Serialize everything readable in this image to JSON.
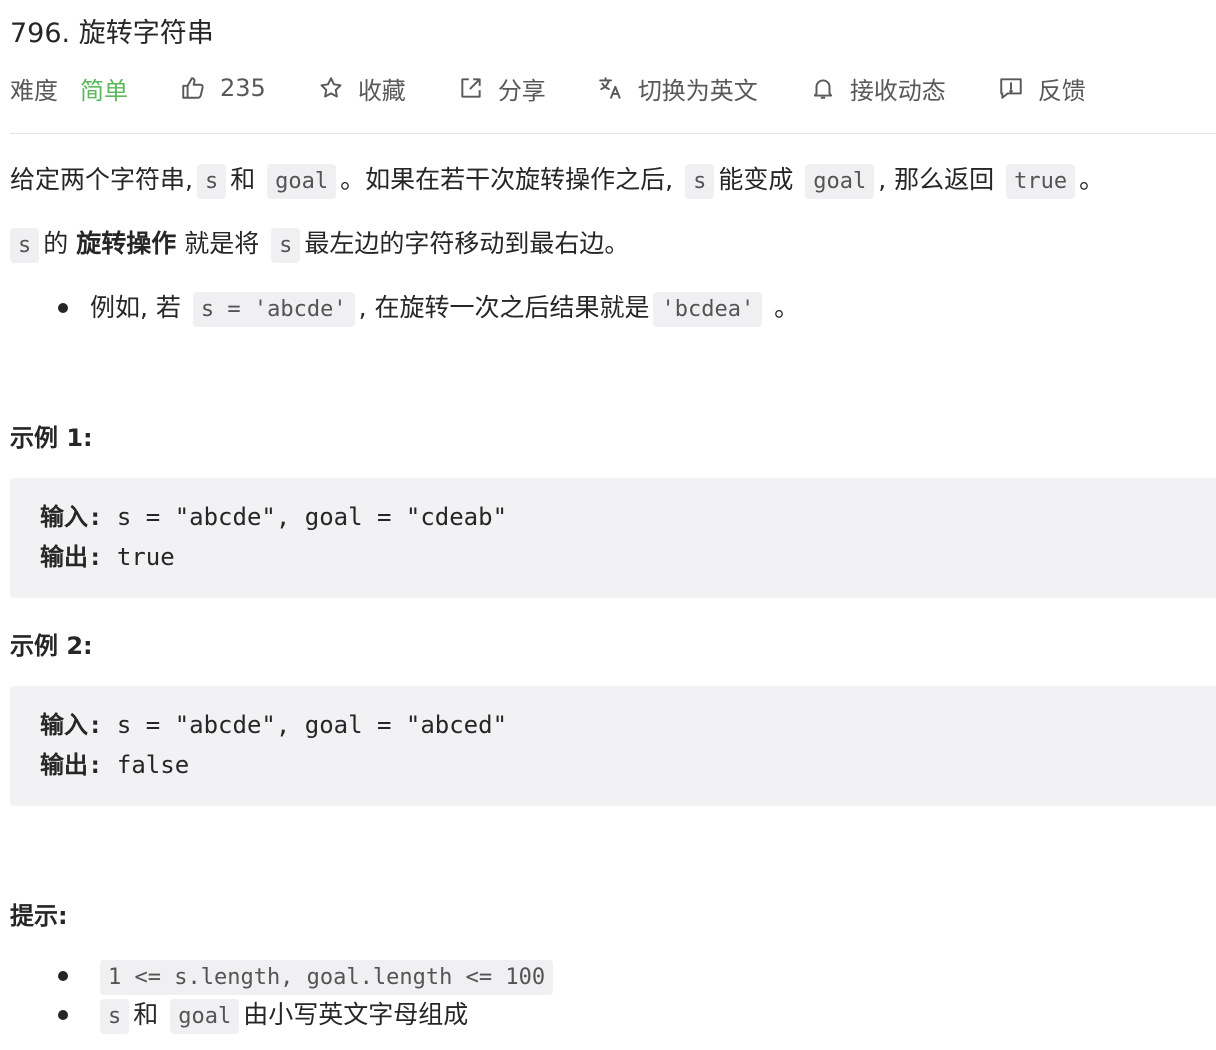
{
  "problem": {
    "title": "796. 旋转字符串"
  },
  "meta": {
    "difficulty_label": "难度",
    "difficulty_value": "简单",
    "likes": "235",
    "favorite": "收藏",
    "share": "分享",
    "switch_lang": "切换为英文",
    "notifications": "接收动态",
    "feedback": "反馈"
  },
  "description": {
    "p1": {
      "t1": "给定两个字符串,",
      "c1": "s",
      "t2": "和",
      "c2": "goal",
      "t3": "。如果在若干次旋转操作之后,",
      "c3": "s",
      "t4": "能变成",
      "c4": "goal",
      "t5": ",  那么返回",
      "c5": "true",
      "t6": "。"
    },
    "p2": {
      "c1": "s",
      "t1": "的",
      "b1": "旋转操作",
      "t2": "就是将",
      "c2": "s",
      "t3": "最左边的字符移动到最右边。"
    },
    "bullet": {
      "t1": "例如, 若",
      "c1": "s = 'abcde'",
      "t2": ",  在旋转一次之后结果就是",
      "c2": "'bcdea'",
      "t3": "。"
    }
  },
  "examples": [
    {
      "title": "示例 1:",
      "input_label": "输入:",
      "input_value": " s = \"abcde\", goal = \"cdeab\"",
      "output_label": "输出:",
      "output_value": " true"
    },
    {
      "title": "示例 2:",
      "input_label": "输入:",
      "input_value": " s = \"abcde\", goal = \"abced\"",
      "output_label": "输出:",
      "output_value": " false"
    }
  ],
  "constraints": {
    "title": "提示:",
    "items": [
      {
        "code": "1 <= s.length, goal.length <= 100"
      },
      {
        "c1": "s",
        "t1": "和",
        "c2": "goal",
        "t2": "由小写英文字母组成"
      }
    ]
  },
  "icons": [
    "thumbs-up-icon",
    "star-icon",
    "share-icon",
    "translate-icon",
    "bell-icon",
    "feedback-icon"
  ],
  "colors": {
    "easy": "#5cb85c",
    "code_bg": "#f0f0f2",
    "text": "#262626",
    "meta_text": "#595959"
  }
}
